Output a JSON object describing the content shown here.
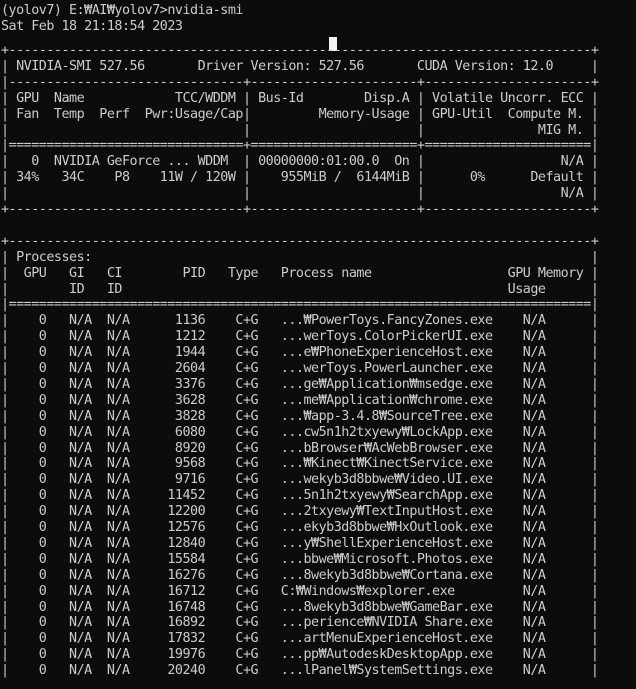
{
  "terminal": {
    "prompt_line": "(yolov7) E:₩AI₩yolov7>nvidia-smi",
    "timestamp": "Sat Feb 18 21:18:54 2023",
    "lines": [
      "+-----------------------------------------------------------------------------+",
      "| NVIDIA-SMI 527.56       Driver Version: 527.56       CUDA Version: 12.0     |",
      "|-------------------------------+----------------------+----------------------+",
      "| GPU  Name            TCC/WDDM | Bus-Id        Disp.A | Volatile Uncorr. ECC |",
      "| Fan  Temp  Perf  Pwr:Usage/Cap|         Memory-Usage | GPU-Util  Compute M. |",
      "|                               |                      |               MIG M. |",
      "|===============================+======================+======================|",
      "|   0  NVIDIA GeForce ... WDDM  | 00000000:01:00.0  On |                  N/A |",
      "| 34%   34C    P8    11W / 120W |    955MiB /  6144MiB |      0%      Default |",
      "|                               |                      |                  N/A |",
      "+-------------------------------+----------------------+----------------------+",
      "",
      "+-----------------------------------------------------------------------------+",
      "| Processes:                                                                  |",
      "|  GPU   GI   CI        PID   Type   Process name                  GPU Memory |",
      "|        ID   ID                                                   Usage      |",
      "|=============================================================================|",
      "|    0   N/A  N/A      1136    C+G   ...₩PowerToys.FancyZones.exe    N/A      |",
      "|    0   N/A  N/A      1212    C+G   ...werToys.ColorPickerUI.exe    N/A      |",
      "|    0   N/A  N/A      1944    C+G   ...e₩PhoneExperienceHost.exe    N/A      |",
      "|    0   N/A  N/A      2604    C+G   ...werToys.PowerLauncher.exe    N/A      |",
      "|    0   N/A  N/A      3376    C+G   ...ge₩Application₩msedge.exe    N/A      |",
      "|    0   N/A  N/A      3628    C+G   ...me₩Application₩chrome.exe    N/A      |",
      "|    0   N/A  N/A      3828    C+G   ...₩app-3.4.8₩SourceTree.exe    N/A      |",
      "|    0   N/A  N/A      6080    C+G   ...cw5n1h2txyewy₩LockApp.exe    N/A      |",
      "|    0   N/A  N/A      8920    C+G   ...bBrowser₩AcWebBrowser.exe    N/A      |",
      "|    0   N/A  N/A      9568    C+G   ...₩Kinect₩KinectService.exe    N/A      |",
      "|    0   N/A  N/A      9716    C+G   ...wekyb3d8bbwe₩Video.UI.exe    N/A      |",
      "|    0   N/A  N/A     11452    C+G   ...5n1h2txyewy₩SearchApp.exe    N/A      |",
      "|    0   N/A  N/A     12200    C+G   ...2txyewy₩TextInputHost.exe    N/A      |",
      "|    0   N/A  N/A     12576    C+G   ...ekyb3d8bbwe₩HxOutlook.exe    N/A      |",
      "|    0   N/A  N/A     12840    C+G   ...y₩ShellExperienceHost.exe    N/A      |",
      "|    0   N/A  N/A     15584    C+G   ...bbwe₩Microsoft.Photos.exe    N/A      |",
      "|    0   N/A  N/A     16276    C+G   ...8wekyb3d8bbwe₩Cortana.exe    N/A      |",
      "|    0   N/A  N/A     16712    C+G   C:₩Windows₩explorer.exe         N/A      |",
      "|    0   N/A  N/A     16748    C+G   ...8wekyb3d8bbwe₩GameBar.exe    N/A      |",
      "|    0   N/A  N/A     16892    C+G   ...perience₩NVIDIA Share.exe    N/A      |",
      "|    0   N/A  N/A     17832    C+G   ...artMenuExperienceHost.exe    N/A      |",
      "|    0   N/A  N/A     19976    C+G   ...pp₩AutodeskDesktopApp.exe    N/A      |",
      "|    0   N/A  N/A     20240    C+G   ...lPanel₩SystemSettings.exe    N/A      |"
    ]
  }
}
